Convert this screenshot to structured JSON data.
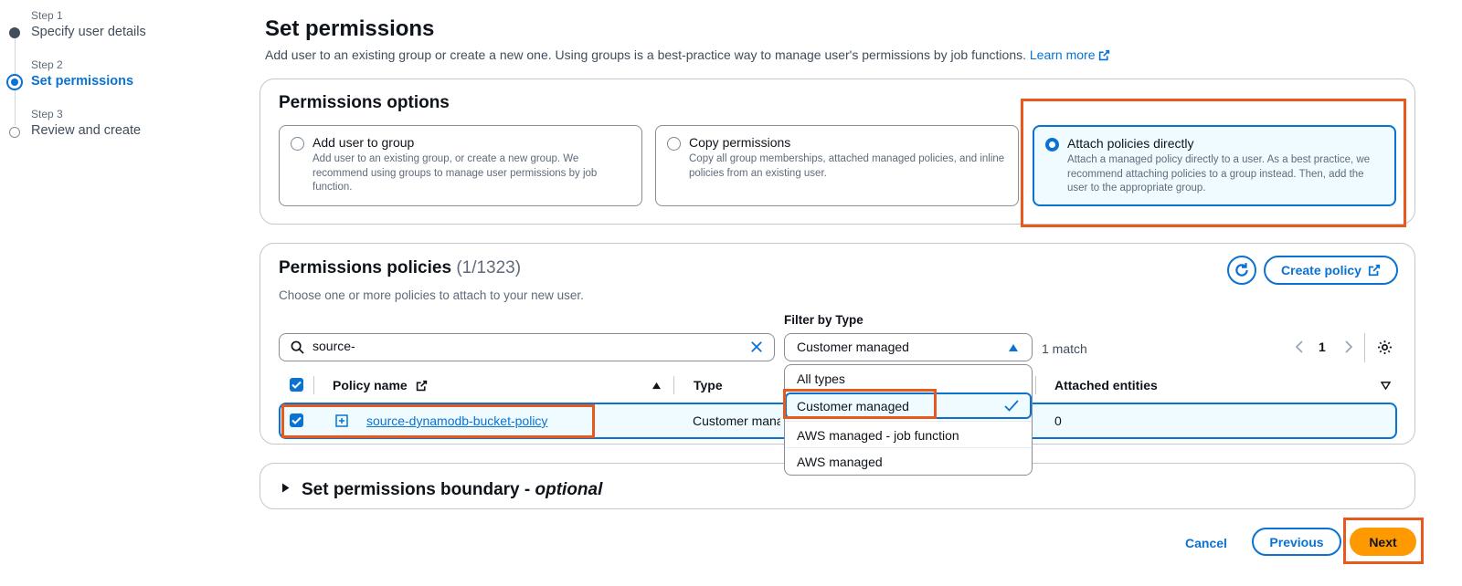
{
  "steps": [
    {
      "number": "Step 1",
      "title": "Specify user details",
      "state": "done"
    },
    {
      "number": "Step 2",
      "title": "Set permissions",
      "state": "current"
    },
    {
      "number": "Step 3",
      "title": "Review and create",
      "state": "todo"
    }
  ],
  "page": {
    "title": "Set permissions",
    "description": "Add user to an existing group or create a new one. Using groups is a best-practice way to manage user's permissions by job functions.",
    "learn_more": "Learn more"
  },
  "permissions_options": {
    "heading": "Permissions options",
    "options": [
      {
        "title": "Add user to group",
        "description": "Add user to an existing group, or create a new group. We recommend using groups to manage user permissions by job function.",
        "selected": false
      },
      {
        "title": "Copy permissions",
        "description": "Copy all group memberships, attached managed policies, and inline policies from an existing user.",
        "selected": false
      },
      {
        "title": "Attach policies directly",
        "description": "Attach a managed policy directly to a user. As a best practice, we recommend attaching policies to a group instead. Then, add the user to the appropriate group.",
        "selected": true
      }
    ]
  },
  "policies": {
    "heading": "Permissions policies",
    "count": "(1/1323)",
    "description": "Choose one or more policies to attach to your new user.",
    "create_policy": "Create policy",
    "search_value": "source-",
    "filter_label": "Filter by Type",
    "filter_value": "Customer managed",
    "match_text": "1 match",
    "page_number": "1",
    "columns": {
      "policy_name": "Policy name",
      "type": "Type",
      "attached": "Attached entities"
    },
    "rows": [
      {
        "name": "source-dynamodb-bucket-policy",
        "type": "Customer managed",
        "attached": "0",
        "checked": true
      }
    ],
    "filter_options": [
      {
        "label": "All types",
        "selected": false
      },
      {
        "label": "Customer managed",
        "selected": true
      },
      {
        "label": "AWS managed - job function",
        "selected": false
      },
      {
        "label": "AWS managed",
        "selected": false
      }
    ]
  },
  "boundary": {
    "title": "Set permissions boundary - ",
    "optional": "optional"
  },
  "footer": {
    "cancel": "Cancel",
    "previous": "Previous",
    "next": "Next"
  },
  "colors": {
    "accent": "#0972d3",
    "primary_button": "#ff9900",
    "highlight": "#e8591e"
  },
  "icons": [
    "ext-link-icon",
    "refresh-icon",
    "search-icon",
    "clear-icon",
    "caret-up-icon",
    "settings-icon",
    "check-icon",
    "expand-icon",
    "caret-right-icon",
    "sort-asc-icon",
    "sort-desc-icon",
    "chevron-left-icon",
    "chevron-right-icon"
  ]
}
